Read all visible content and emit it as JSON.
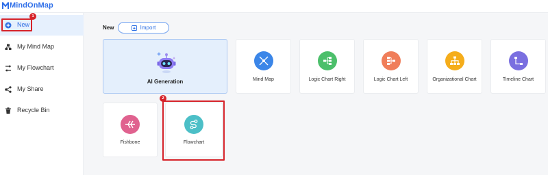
{
  "app": {
    "logo_text": "MindOnMap"
  },
  "sidebar": {
    "items": [
      {
        "label": "New",
        "icon": "plus-circle-icon",
        "active": true
      },
      {
        "label": "My Mind Map",
        "icon": "mind-map-icon"
      },
      {
        "label": "My Flowchart",
        "icon": "flowchart-icon"
      },
      {
        "label": "My Share",
        "icon": "share-icon"
      },
      {
        "label": "Recycle Bin",
        "icon": "trash-icon"
      }
    ],
    "step_badge": "1"
  },
  "main": {
    "section_title": "New",
    "import_label": "Import",
    "ai_card": {
      "label": "AI Generation",
      "icon": "ai-robot-icon"
    },
    "templates": [
      {
        "label": "Mind Map",
        "icon": "mind-map-icon",
        "color": "#3b86e8"
      },
      {
        "label": "Logic Chart Right",
        "icon": "logic-right-icon",
        "color": "#4cbf6b"
      },
      {
        "label": "Logic Chart Left",
        "icon": "logic-left-icon",
        "color": "#f07e5a"
      },
      {
        "label": "Organizational Chart",
        "icon": "org-chart-icon",
        "color": "#f5ad1b"
      },
      {
        "label": "Timeline Chart",
        "icon": "timeline-icon",
        "color": "#7a6fe0"
      },
      {
        "label": "Fishbone",
        "icon": "fishbone-icon",
        "color": "#e0628f"
      },
      {
        "label": "Flowchart",
        "icon": "flowchart-icon",
        "color": "#4cbfc7"
      }
    ],
    "step_badge": "2"
  },
  "colors": {
    "accent": "#2c6fe3",
    "highlight": "#d6232a"
  }
}
